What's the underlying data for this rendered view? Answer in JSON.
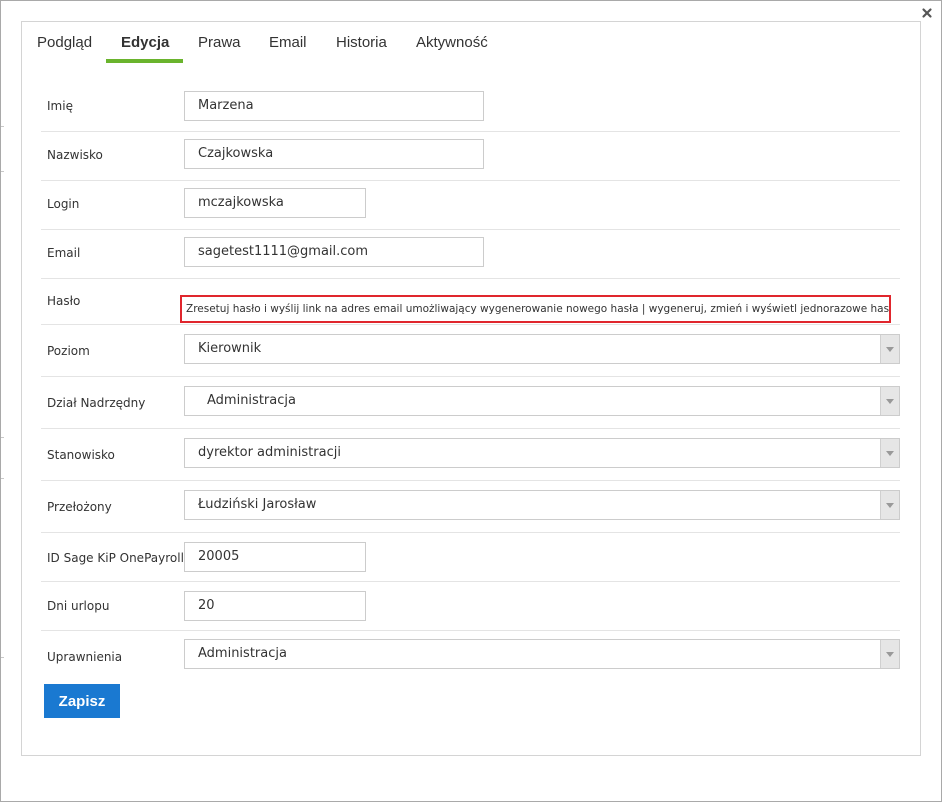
{
  "tabs": [
    {
      "label": "Podgląd"
    },
    {
      "label": "Edycja"
    },
    {
      "label": "Prawa"
    },
    {
      "label": "Email"
    },
    {
      "label": "Historia"
    },
    {
      "label": "Aktywność"
    }
  ],
  "active_tab": "Edycja",
  "accent_color": "#6ab42d",
  "button_color": "#1a79d1",
  "highlight_color": "#e0262d",
  "icons": {
    "close": "close-icon",
    "dropdown": "chevron-down-icon"
  },
  "form": {
    "first_name": {
      "label": "Imię",
      "value": "Marzena"
    },
    "last_name": {
      "label": "Nazwisko",
      "value": "Czajkowska"
    },
    "login": {
      "label": "Login",
      "value": "mczajkowska"
    },
    "email": {
      "label": "Email",
      "value": "sagetest1111@gmail.com"
    },
    "password": {
      "label": "Hasło",
      "reset_link": "Zresetuj hasło i wyślij link na adres email umożliwający wygenerowanie nowego hasła",
      "separator": " | ",
      "generate_link": "wygeneruj, zmień i wyświetl jednorazowe hasło"
    },
    "level": {
      "label": "Poziom",
      "value": "Kierownik"
    },
    "parent_department": {
      "label": "Dział Nadrzędny",
      "value": "Administracja"
    },
    "position": {
      "label": "Stanowisko",
      "value": "dyrektor administracji"
    },
    "supervisor": {
      "label": "Przełożony",
      "value": "Łudziński Jarosław"
    },
    "payroll_id": {
      "label": "ID Sage KiP OnePayroll",
      "value": "20005"
    },
    "vacation_days": {
      "label": "Dni urlopu",
      "value": "20"
    },
    "permissions": {
      "label": "Uprawnienia",
      "value": "Administracja"
    }
  },
  "save_label": "Zapisz"
}
